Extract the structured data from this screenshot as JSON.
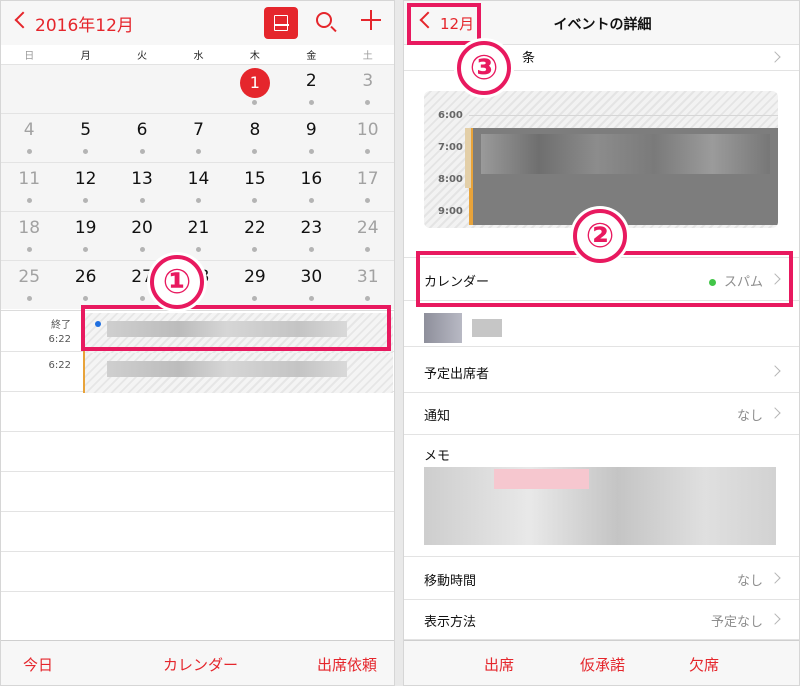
{
  "left": {
    "nav": {
      "month_title": "2016年12月"
    },
    "weekdays": [
      "日",
      "月",
      "火",
      "水",
      "木",
      "金",
      "土"
    ],
    "weeks": [
      [
        "",
        "",
        "",
        "",
        "1",
        "2",
        "3"
      ],
      [
        "4",
        "5",
        "6",
        "7",
        "8",
        "9",
        "10"
      ],
      [
        "11",
        "12",
        "13",
        "14",
        "15",
        "16",
        "17"
      ],
      [
        "18",
        "19",
        "20",
        "21",
        "22",
        "23",
        "24"
      ],
      [
        "25",
        "26",
        "27",
        "28",
        "29",
        "30",
        "31"
      ]
    ],
    "today": "1",
    "events": [
      {
        "time_label": "終了",
        "time": "6:22"
      },
      {
        "time_label": "",
        "time": "6:22"
      }
    ],
    "tabbar": {
      "today": "今日",
      "calendars": "カレンダー",
      "inbox": "出席依頼"
    }
  },
  "right": {
    "nav": {
      "back": "12月",
      "title": "イベントの詳細"
    },
    "top_row_partial": "条",
    "timeline_hours": [
      "6:00",
      "7:00",
      "8:00",
      "9:00"
    ],
    "rows": {
      "calendar": {
        "label": "カレンダー",
        "value": "スパム"
      },
      "invitees": {
        "label": "予定出席者"
      },
      "alert": {
        "label": "通知",
        "value": "なし"
      },
      "notes": {
        "label": "メモ"
      },
      "travel": {
        "label": "移動時間",
        "value": "なし"
      },
      "show_as": {
        "label": "表示方法",
        "value": "予定なし"
      }
    },
    "tabbar": {
      "accept": "出席",
      "maybe": "仮承諾",
      "decline": "欠席"
    }
  },
  "annotations": {
    "step1": "①",
    "step2": "②",
    "step3": "③"
  },
  "colors": {
    "accent": "#e5262c",
    "callout": "#e8195f",
    "calendar_dot": "#42c548",
    "event_bar": "#e8a33a",
    "event_dot": "#1f6fe0"
  }
}
